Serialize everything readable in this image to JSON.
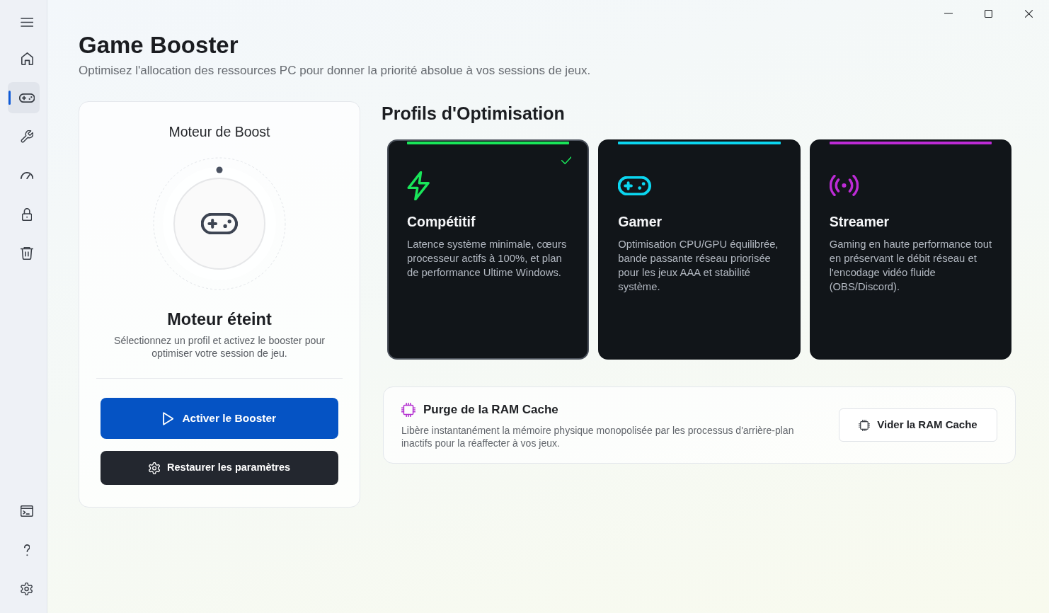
{
  "header": {
    "title": "Game Booster",
    "subtitle": "Optimisez l'allocation des ressources PC pour donner la priorité absolue à vos sessions de jeux."
  },
  "sidebar": {
    "nav_items": [
      {
        "selected": false
      },
      {
        "selected": true
      },
      {
        "selected": false
      },
      {
        "selected": false
      },
      {
        "selected": false
      },
      {
        "selected": false
      }
    ],
    "footer_items": [
      {
        "selected": false
      },
      {
        "selected": false
      },
      {
        "selected": false
      }
    ]
  },
  "boost_engine": {
    "title": "Moteur de Boost",
    "status": "Moteur éteint",
    "description": "Sélectionnez un profil et activez le booster pour optimiser votre session de jeu.",
    "buttons": [
      {
        "kind": "primary",
        "label": "Activer le Booster"
      },
      {
        "kind": "secondary",
        "label": "Restaurer les paramètres"
      }
    ]
  },
  "profiles": {
    "title": "Profils d'Optimisation",
    "items": [
      {
        "name": "Compétitif",
        "description": "Latence système minimale, cœurs processeur actifs à 100%, et plan de performance Ultime Windows.",
        "color": "#19e65a",
        "selected": true
      },
      {
        "name": "Gamer",
        "description": "Optimisation CPU/GPU équilibrée, bande passante réseau priorisée pour les jeux AAA et stabilité système.",
        "color": "#0bd6f0",
        "selected": false
      },
      {
        "name": "Streamer",
        "description": "Gaming en haute performance tout en préservant le débit réseau et l'encodage vidéo fluide (OBS/Discord).",
        "color": "#bd2bd6",
        "selected": false
      }
    ]
  },
  "ram_purge": {
    "title": "Purge de la RAM Cache",
    "description": "Libère instantanément la mémoire physique monopolisée par les processus d'arrière-plan inactifs pour la réaffecter à vos jeux.",
    "button": "Vider la RAM Cache"
  }
}
